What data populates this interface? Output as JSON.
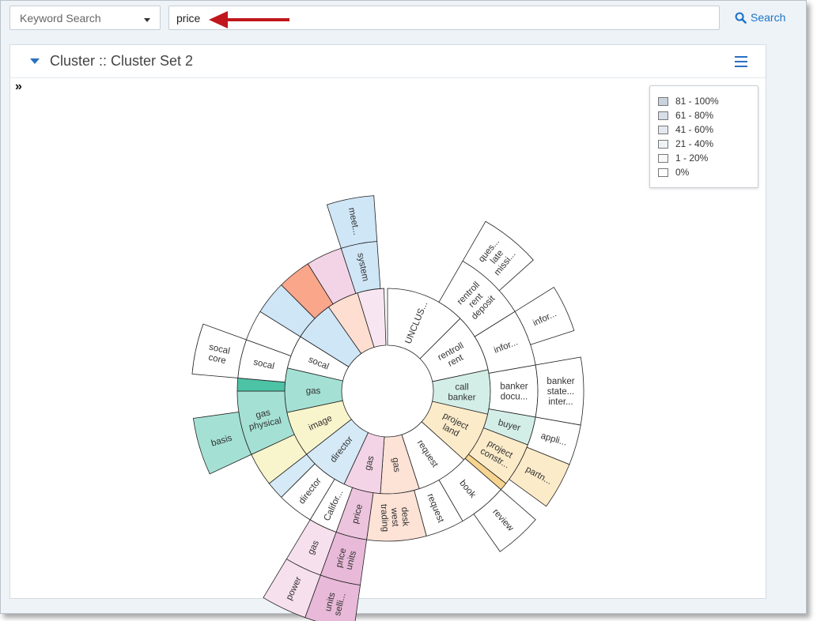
{
  "search": {
    "type_label": "Keyword Search",
    "query": "price",
    "button_label": "Search"
  },
  "panel": {
    "title": "Cluster :: Cluster Set 2",
    "expand_glyph": "»"
  },
  "legend": [
    {
      "label": "81 - 100%",
      "color": "#c9d3de"
    },
    {
      "label": "61 - 80%",
      "color": "#d6dee7"
    },
    {
      "label": "41 - 60%",
      "color": "#e4e9ef"
    },
    {
      "label": "21 - 40%",
      "color": "#f0f3f6"
    },
    {
      "label": "1 - 20%",
      "color": "#f8f9fb"
    },
    {
      "label": "0%",
      "color": "#ffffff"
    }
  ],
  "sunburst": {
    "ring1": [
      {
        "a0": 0,
        "a1": 45,
        "label": [
          "UNCLUS..."
        ],
        "color": "#ffffff"
      },
      {
        "a0": 45,
        "a1": 78,
        "label": [
          "rentroll",
          "rent"
        ],
        "color": "#ffffff"
      },
      {
        "a0": 78,
        "a1": 103,
        "label": [
          "call",
          "banker"
        ],
        "color": "#d3eee7"
      },
      {
        "a0": 103,
        "a1": 132,
        "label": [
          "project",
          "land"
        ],
        "color": "#fcebc9"
      },
      {
        "a0": 132,
        "a1": 162,
        "label": [
          "request"
        ],
        "color": "#ffffff"
      },
      {
        "a0": 162,
        "a1": 184,
        "label": [
          "gas"
        ],
        "color": "#fde2d6"
      },
      {
        "a0": 184,
        "a1": 205,
        "label": [
          "gas"
        ],
        "color": "#f3d4e6"
      },
      {
        "a0": 205,
        "a1": 232,
        "label": [
          "director"
        ],
        "color": "#d5e9f6"
      },
      {
        "a0": 232,
        "a1": 258,
        "label": [
          "image"
        ],
        "color": "#f8f4cc"
      },
      {
        "a0": 258,
        "a1": 283,
        "label": [
          "gas"
        ],
        "color": "#a4e1d4"
      },
      {
        "a0": 283,
        "a1": 302,
        "label": [
          "socal"
        ],
        "color": "#ffffff"
      },
      {
        "a0": 302,
        "a1": 325,
        "label": [
          ""
        ],
        "color": "#cfe6f7"
      },
      {
        "a0": 325,
        "a1": 343,
        "label": [
          ""
        ],
        "color": "#fdded1"
      },
      {
        "a0": 343,
        "a1": 358,
        "label": [
          ""
        ],
        "color": "#f7e6f1"
      }
    ],
    "ring2": [
      {
        "a0": 30,
        "a1": 58,
        "label": [
          "rentroll",
          "rent",
          "deposit"
        ],
        "color": "#ffffff"
      },
      {
        "a0": 58,
        "a1": 80,
        "label": [
          "infor..."
        ],
        "color": "#ffffff"
      },
      {
        "a0": 80,
        "a1": 100,
        "label": [
          "banker",
          "docu..."
        ],
        "color": "#ffffff"
      },
      {
        "a0": 100,
        "a1": 111,
        "label": [
          "buyer"
        ],
        "color": "#d3eee7"
      },
      {
        "a0": 111,
        "a1": 128,
        "label": [
          "project",
          "constr..."
        ],
        "color": "#fcebc9"
      },
      {
        "a0": 128,
        "a1": 131,
        "label": [
          ""
        ],
        "color": "#f7d48f"
      },
      {
        "a0": 131,
        "a1": 150,
        "label": [
          "book"
        ],
        "color": "#ffffff"
      },
      {
        "a0": 150,
        "a1": 165,
        "label": [
          "request"
        ],
        "color": "#ffffff"
      },
      {
        "a0": 165,
        "a1": 188,
        "label": [
          "desk",
          "west",
          "trading"
        ],
        "color": "#fde2d6"
      },
      {
        "a0": 188,
        "a1": 200,
        "label": [
          "price"
        ],
        "color": "#ecc4dd"
      },
      {
        "a0": 200,
        "a1": 211,
        "label": [
          "Califor..."
        ],
        "color": "#ffffff"
      },
      {
        "a0": 211,
        "a1": 225,
        "label": [
          "director"
        ],
        "color": "#ffffff"
      },
      {
        "a0": 225,
        "a1": 232,
        "label": [
          ""
        ],
        "color": "#d5e9f6"
      },
      {
        "a0": 232,
        "a1": 245,
        "label": [
          ""
        ],
        "color": "#f8f4cc"
      },
      {
        "a0": 245,
        "a1": 270,
        "label": [
          "gas",
          "physical"
        ],
        "color": "#a4e1d4"
      },
      {
        "a0": 270,
        "a1": 275,
        "label": [
          ""
        ],
        "color": "#4cc3a5"
      },
      {
        "a0": 275,
        "a1": 290,
        "label": [
          "socal"
        ],
        "color": "#ffffff"
      },
      {
        "a0": 290,
        "a1": 302,
        "label": [
          ""
        ],
        "color": "#ffffff"
      },
      {
        "a0": 302,
        "a1": 315,
        "label": [
          ""
        ],
        "color": "#cfe6f7"
      },
      {
        "a0": 315,
        "a1": 328,
        "label": [
          ""
        ],
        "color": "#f9a68a"
      },
      {
        "a0": 328,
        "a1": 342,
        "label": [
          ""
        ],
        "color": "#f3d4e6"
      },
      {
        "a0": 342,
        "a1": 356,
        "label": [
          "system"
        ],
        "color": "#cfe6f7"
      }
    ],
    "ring3": [
      {
        "a0": 30,
        "a1": 48,
        "label": [
          "ques...",
          "late",
          "missi..."
        ],
        "color": "#ffffff"
      },
      {
        "a0": 58,
        "a1": 72,
        "label": [
          "infor..."
        ],
        "color": "#ffffff"
      },
      {
        "a0": 80,
        "a1": 100,
        "label": [
          "banker",
          "state...",
          "inter..."
        ],
        "color": "#ffffff"
      },
      {
        "a0": 100,
        "a1": 112,
        "label": [
          "appli..."
        ],
        "color": "#ffffff"
      },
      {
        "a0": 112,
        "a1": 126,
        "label": [
          "partn..."
        ],
        "color": "#fcebc9"
      },
      {
        "a0": 131,
        "a1": 145,
        "label": [
          "review"
        ],
        "color": "#ffffff"
      },
      {
        "a0": 188,
        "a1": 200,
        "label": [
          "price",
          "units"
        ],
        "color": "#e8b9d8"
      },
      {
        "a0": 200,
        "a1": 211,
        "label": [
          "gas"
        ],
        "color": "#f7e0ee"
      },
      {
        "a0": 245,
        "a1": 262,
        "label": [
          "basis"
        ],
        "color": "#a4e1d4"
      },
      {
        "a0": 275,
        "a1": 290,
        "label": [
          "socal",
          "core"
        ],
        "color": "#ffffff"
      },
      {
        "a0": 342,
        "a1": 356,
        "label": [
          "meet..."
        ],
        "color": "#cfe6f7"
      }
    ],
    "ring4": [
      {
        "a0": 188,
        "a1": 200,
        "label": [
          "units",
          "selli..."
        ],
        "color": "#e8b9d8"
      },
      {
        "a0": 200,
        "a1": 211,
        "label": [
          "power"
        ],
        "color": "#f7e0ee"
      }
    ]
  }
}
